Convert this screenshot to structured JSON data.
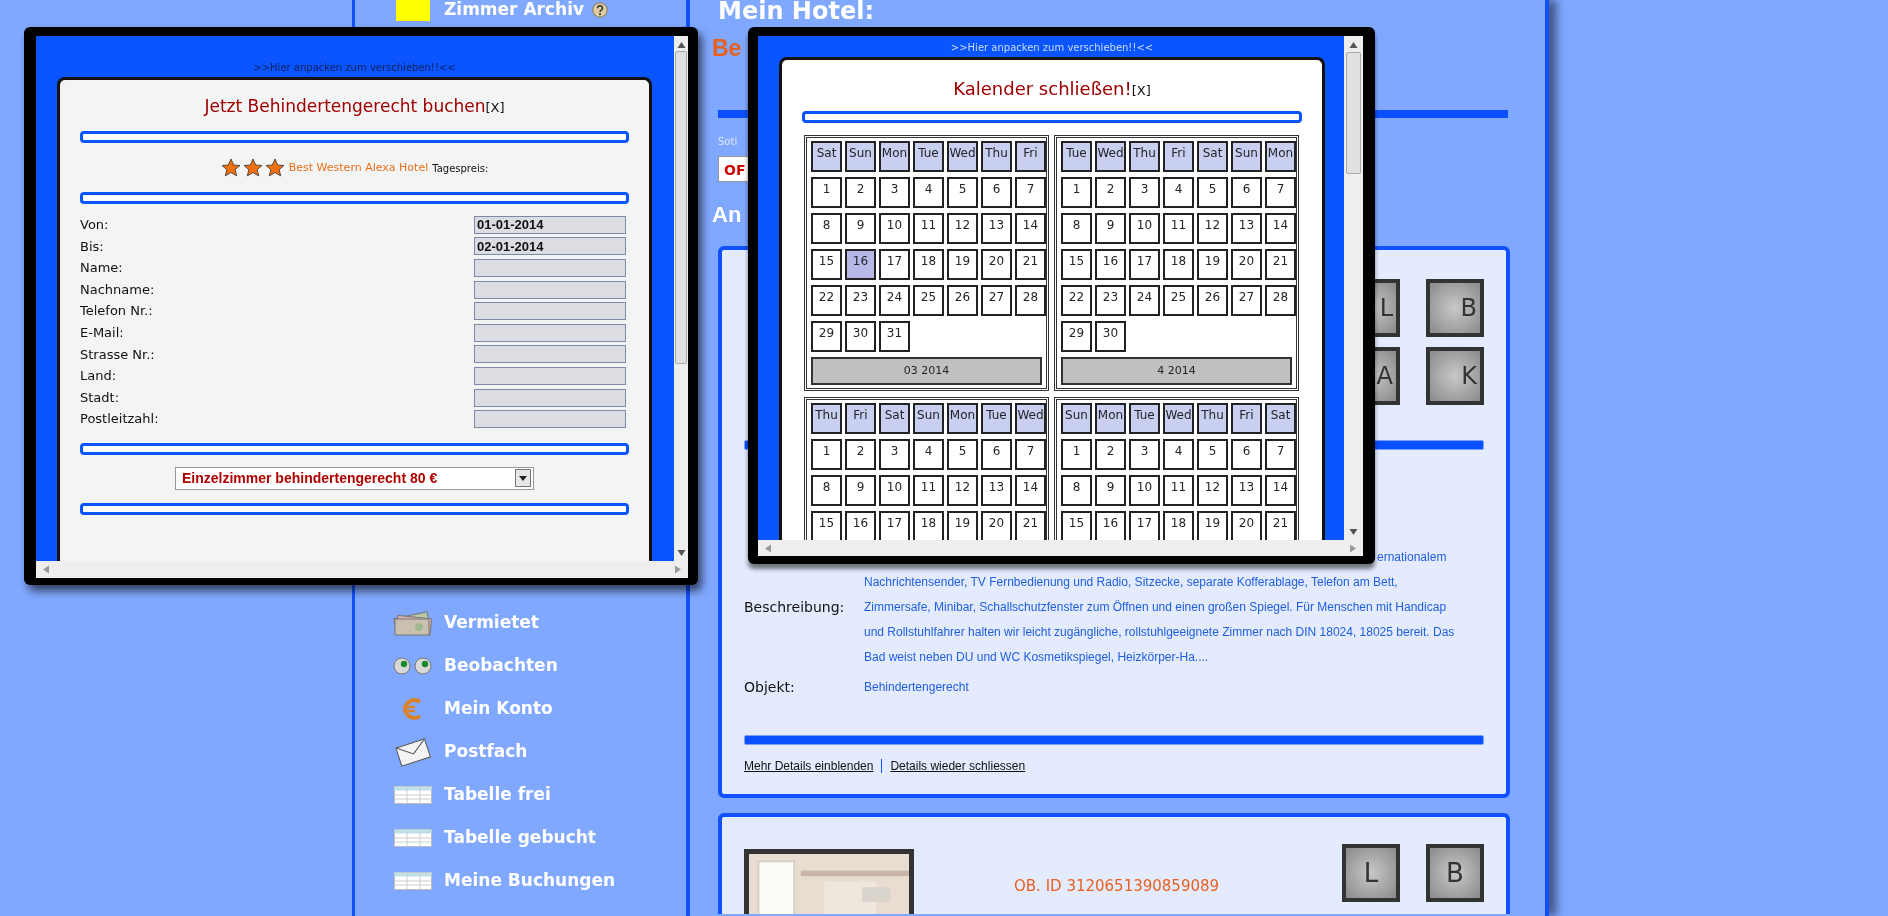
{
  "sidebar": {
    "upper_items": [
      {
        "label": "Zimmer Archiv"
      }
    ],
    "lower_items": [
      {
        "label": "Vermietet"
      },
      {
        "label": "Beobachten"
      },
      {
        "label": "Mein Konto"
      },
      {
        "label": "Postfach"
      },
      {
        "label": "Tabelle frei"
      },
      {
        "label": "Tabelle gebucht"
      },
      {
        "label": "Meine Buchungen"
      }
    ]
  },
  "main": {
    "title": "Mein Hotel:",
    "hotel_name": "Be",
    "sort_label": "Soti",
    "sort_select": {
      "value": "OF"
    },
    "section_heading": "An",
    "offers": [
      {
        "kind": "details",
        "letter_buttons": [
          "L",
          "B",
          "A",
          "K"
        ],
        "description_label": "Beschreibung:",
        "description_lines": [
          "ernationalem",
          "Nachrichtensender, TV Fernbedienung und Radio, Sitzecke, separate Kofferablage, Telefon am Bett,",
          "Zimmersafe, Minibar, Schallschutzfenster zum Öffnen und einen großen Spiegel. Für Menschen mit Handicap",
          "und Rollstuhlfahrer halten wir leicht zugängliche, rollstuhlgeeignete Zimmer nach DIN 18024, 18025 bereit. Das",
          "Bad weist neben DU und WC Kosmetikspiegel, Heizkörper-Ha...."
        ],
        "object_label": "Objekt:",
        "object_value": "Behindertengerecht",
        "links": [
          "Mehr Details einblenden",
          "Details wieder schliessen"
        ]
      },
      {
        "kind": "summary",
        "object_id": "OB. ID 3120651390859089",
        "letter_buttons": [
          "L",
          "B"
        ]
      }
    ]
  },
  "booking_window": {
    "handle": ">>Hier anpacken zum verschieben!!<<",
    "title": "Jetzt Behindertengerecht buchen",
    "close": "[X]",
    "stars": 3,
    "hotel": "Best Western Alexa Hotel",
    "price_label": "Tagespreis:",
    "fields": [
      {
        "label": "Von:",
        "value": "01-01-2014"
      },
      {
        "label": "Bis:",
        "value": "02-01-2014"
      },
      {
        "label": "Name:"
      },
      {
        "label": "Nachname:"
      },
      {
        "label": "Telefon Nr.:"
      },
      {
        "label": "E-Mail:"
      },
      {
        "label": "Strasse Nr.:"
      },
      {
        "label": "Land:"
      },
      {
        "label": "Stadt:"
      },
      {
        "label": "Postleitzahl:"
      }
    ],
    "room_select": {
      "value": "Einzelzimmer behindertengerecht 80 €"
    }
  },
  "calendar_window": {
    "handle": ">>Hier anpacken zum verschieben!!<<",
    "title": "Kalender schließen!",
    "close": "[X]",
    "months": [
      {
        "label": "03 2014",
        "weekdays": [
          "Sat",
          "Sun",
          "Mon",
          "Tue",
          "Wed",
          "Thu",
          "Fri"
        ],
        "days": [
          {
            "day": "1",
            "selected": false
          },
          {
            "day": "2",
            "selected": false
          },
          {
            "day": "3",
            "selected": false
          },
          {
            "day": "4",
            "selected": false
          },
          {
            "day": "5",
            "selected": false
          },
          {
            "day": "6",
            "selected": false
          },
          {
            "day": "7",
            "selected": false
          },
          {
            "day": "8",
            "selected": false
          },
          {
            "day": "9",
            "selected": false
          },
          {
            "day": "10",
            "selected": false
          },
          {
            "day": "11",
            "selected": false
          },
          {
            "day": "12",
            "selected": false
          },
          {
            "day": "13",
            "selected": false
          },
          {
            "day": "14",
            "selected": false
          },
          {
            "day": "15",
            "selected": false
          },
          {
            "day": "16",
            "selected": true
          },
          {
            "day": "17",
            "selected": false
          },
          {
            "day": "18",
            "selected": false
          },
          {
            "day": "19",
            "selected": false
          },
          {
            "day": "20",
            "selected": false
          },
          {
            "day": "21",
            "selected": false
          },
          {
            "day": "22",
            "selected": false
          },
          {
            "day": "23",
            "selected": false
          },
          {
            "day": "24",
            "selected": false
          },
          {
            "day": "25",
            "selected": false
          },
          {
            "day": "26",
            "selected": false
          },
          {
            "day": "27",
            "selected": false
          },
          {
            "day": "28",
            "selected": false
          },
          {
            "day": "29",
            "selected": false
          },
          {
            "day": "30",
            "selected": false
          },
          {
            "day": "31",
            "selected": false
          }
        ]
      },
      {
        "label": "4 2014",
        "weekdays": [
          "Tue",
          "Wed",
          "Thu",
          "Fri",
          "Sat",
          "Sun",
          "Mon"
        ],
        "days": [
          {
            "day": "1",
            "selected": false
          },
          {
            "day": "2",
            "selected": false
          },
          {
            "day": "3",
            "selected": false
          },
          {
            "day": "4",
            "selected": false
          },
          {
            "day": "5",
            "selected": false
          },
          {
            "day": "6",
            "selected": false
          },
          {
            "day": "7",
            "selected": false
          },
          {
            "day": "8",
            "selected": false
          },
          {
            "day": "9",
            "selected": false
          },
          {
            "day": "10",
            "selected": false
          },
          {
            "day": "11",
            "selected": false
          },
          {
            "day": "12",
            "selected": false
          },
          {
            "day": "13",
            "selected": false
          },
          {
            "day": "14",
            "selected": false
          },
          {
            "day": "15",
            "selected": false
          },
          {
            "day": "16",
            "selected": false
          },
          {
            "day": "17",
            "selected": false
          },
          {
            "day": "18",
            "selected": false
          },
          {
            "day": "19",
            "selected": false
          },
          {
            "day": "20",
            "selected": false
          },
          {
            "day": "21",
            "selected": false
          },
          {
            "day": "22",
            "selected": false
          },
          {
            "day": "23",
            "selected": false
          },
          {
            "day": "24",
            "selected": false
          },
          {
            "day": "25",
            "selected": false
          },
          {
            "day": "26",
            "selected": false
          },
          {
            "day": "27",
            "selected": false
          },
          {
            "day": "28",
            "selected": false
          },
          {
            "day": "29",
            "selected": false
          },
          {
            "day": "30",
            "selected": false
          }
        ]
      },
      {
        "weekdays": [
          "Thu",
          "Fri",
          "Sat",
          "Sun",
          "Mon",
          "Tue",
          "Wed"
        ],
        "days": [
          {
            "day": "1",
            "selected": false
          },
          {
            "day": "2",
            "selected": false
          },
          {
            "day": "3",
            "selected": false
          },
          {
            "day": "4",
            "selected": false
          },
          {
            "day": "5",
            "selected": false
          },
          {
            "day": "6",
            "selected": false
          },
          {
            "day": "7",
            "selected": false
          },
          {
            "day": "8",
            "selected": false
          },
          {
            "day": "9",
            "selected": false
          },
          {
            "day": "10",
            "selected": false
          },
          {
            "day": "11",
            "selected": false
          },
          {
            "day": "12",
            "selected": false
          },
          {
            "day": "13",
            "selected": false
          },
          {
            "day": "14",
            "selected": false
          },
          {
            "day": "15",
            "selected": false
          },
          {
            "day": "16",
            "selected": false
          },
          {
            "day": "17",
            "selected": false
          },
          {
            "day": "18",
            "selected": false
          },
          {
            "day": "19",
            "selected": false
          },
          {
            "day": "20",
            "selected": false
          },
          {
            "day": "21",
            "selected": false
          }
        ]
      },
      {
        "weekdays": [
          "Sun",
          "Mon",
          "Tue",
          "Wed",
          "Thu",
          "Fri",
          "Sat"
        ],
        "days": [
          {
            "day": "1",
            "selected": false
          },
          {
            "day": "2",
            "selected": false
          },
          {
            "day": "3",
            "selected": false
          },
          {
            "day": "4",
            "selected": false
          },
          {
            "day": "5",
            "selected": false
          },
          {
            "day": "6",
            "selected": false
          },
          {
            "day": "7",
            "selected": false
          },
          {
            "day": "8",
            "selected": false
          },
          {
            "day": "9",
            "selected": false
          },
          {
            "day": "10",
            "selected": false
          },
          {
            "day": "11",
            "selected": false
          },
          {
            "day": "12",
            "selected": false
          },
          {
            "day": "13",
            "selected": false
          },
          {
            "day": "14",
            "selected": false
          },
          {
            "day": "15",
            "selected": false
          },
          {
            "day": "16",
            "selected": false
          },
          {
            "day": "17",
            "selected": false
          },
          {
            "day": "18",
            "selected": false
          },
          {
            "day": "19",
            "selected": false
          },
          {
            "day": "20",
            "selected": false
          },
          {
            "day": "21",
            "selected": false
          }
        ]
      }
    ]
  }
}
